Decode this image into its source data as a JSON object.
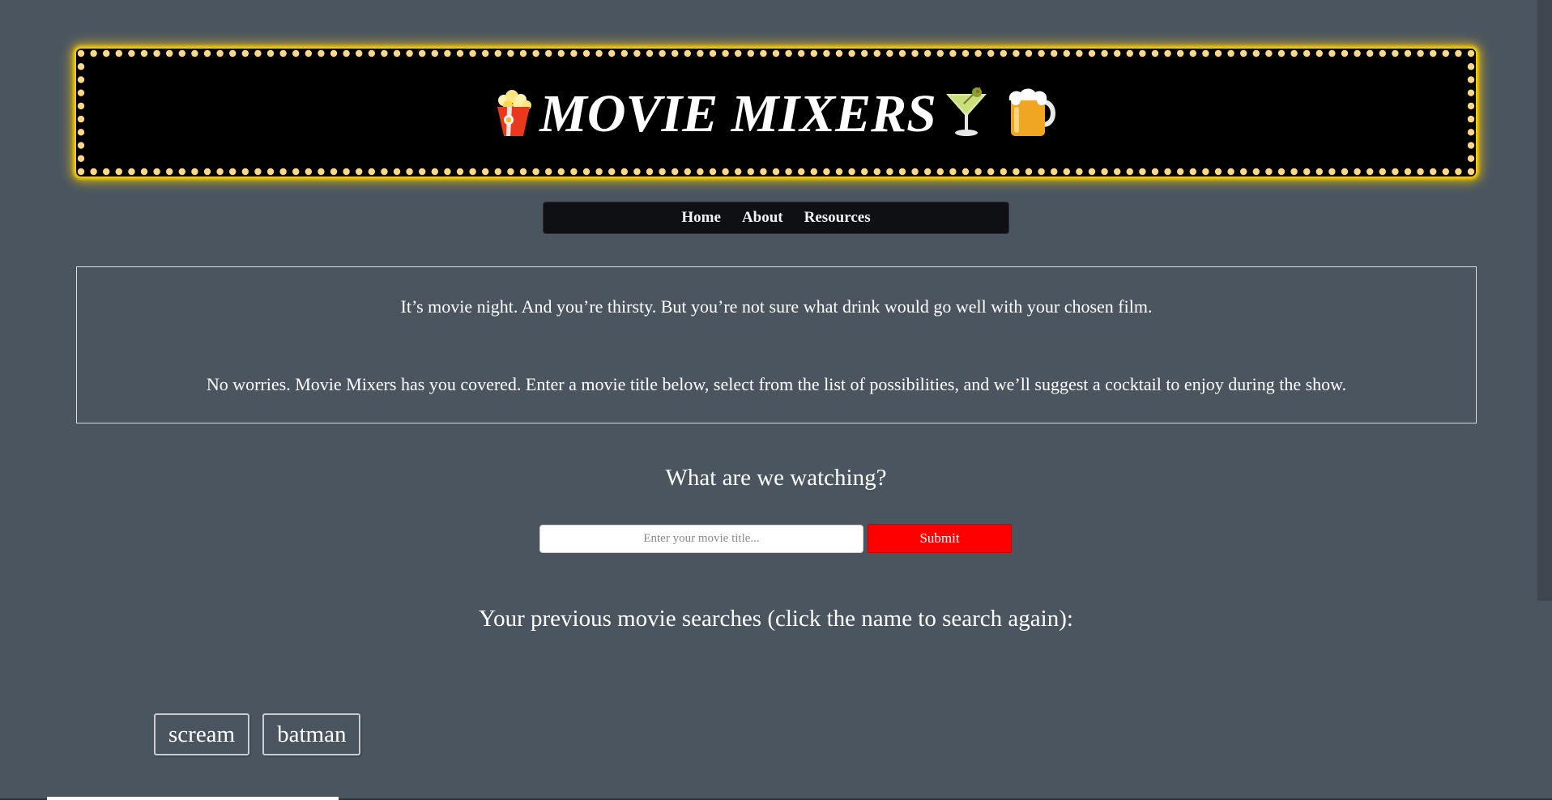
{
  "header": {
    "title": "MOVIE MIXERS",
    "icons": [
      "popcorn-icon",
      "cocktail-icon",
      "beer-mug-icon"
    ],
    "marquee_bulb_color": "#ffd88a",
    "glow_color": "#ffd400"
  },
  "nav": {
    "items": [
      {
        "label": "Home"
      },
      {
        "label": "About"
      },
      {
        "label": "Resources"
      }
    ]
  },
  "intro": {
    "paragraph1": "It’s movie night. And you’re thirsty. But you’re not sure what drink would go well with your chosen film.",
    "paragraph2": "No worries. Movie Mixers has you covered. Enter a movie title below, select from the list of possibilities, and we’ll suggest a cocktail to enjoy during the show."
  },
  "search": {
    "heading": "What are we watching?",
    "placeholder": "Enter your movie title...",
    "value": "",
    "submit_label": "Submit"
  },
  "history": {
    "heading": "Your previous movie searches (click the name to search again):",
    "items": [
      "scream",
      "batman"
    ]
  },
  "colors": {
    "background": "#4a5560",
    "accent_red": "#ff0000",
    "nav_background": "#0e1014"
  }
}
